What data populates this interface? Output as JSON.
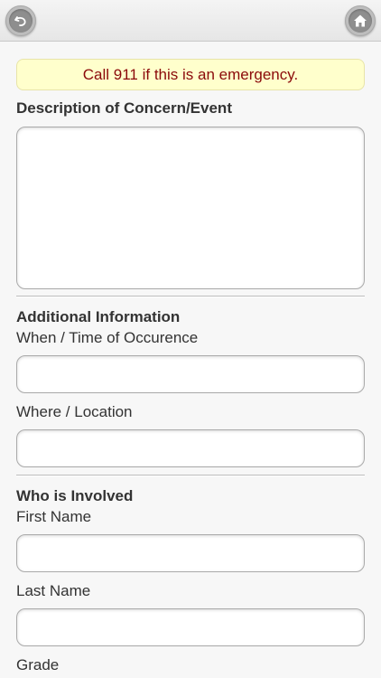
{
  "alert": {
    "text": "Call 911 if this is an emergency."
  },
  "description": {
    "title": "Description of Concern/Event",
    "value": ""
  },
  "additional": {
    "title": "Additional Information",
    "when_label": "When / Time of Occurence",
    "when_value": "",
    "where_label": "Where / Location",
    "where_value": ""
  },
  "involved": {
    "title": "Who is Involved",
    "first_name_label": "First Name",
    "first_name_value": "",
    "last_name_label": "Last Name",
    "last_name_value": "",
    "grade_label": "Grade"
  },
  "icons": {
    "back": "back-arrow-icon",
    "home": "home-icon"
  },
  "colors": {
    "alert_bg": "#ffffcc",
    "alert_text": "#8b0a0a"
  }
}
